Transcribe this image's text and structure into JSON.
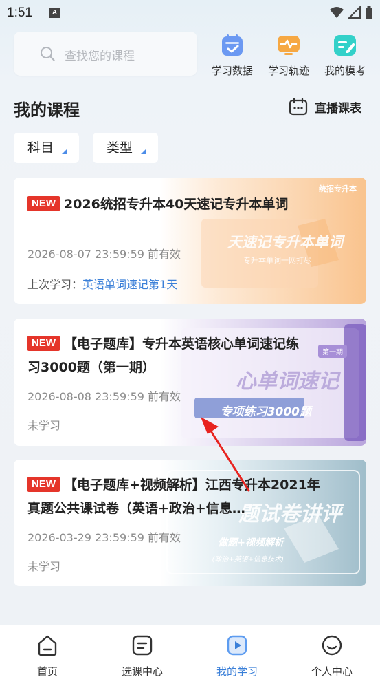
{
  "status_bar": {
    "time": "1:51",
    "a_badge": "A"
  },
  "search": {
    "placeholder": "查找您的课程"
  },
  "quick_actions": [
    {
      "label": "学习数据",
      "icon": "calendar-check-icon",
      "color": "#5b8cf0"
    },
    {
      "label": "学习轨迹",
      "icon": "monitor-wave-icon",
      "color": "#f5a13a"
    },
    {
      "label": "我的模考",
      "icon": "edit-note-icon",
      "color": "#2fd0c8"
    }
  ],
  "section": {
    "title": "我的课程",
    "live_schedule": "直播课表"
  },
  "filters": {
    "subject": "科目",
    "type": "类型"
  },
  "courses": [
    {
      "badge": "NEW",
      "title": "2026统招专升本40天速记专升本单词",
      "expiry": "2026-08-07 23:59:59 前有效",
      "last_label": "上次学习：",
      "last_link": "英语单词速记第1天",
      "cover_tag": "统招专升本",
      "cover_text": "天速记专升本单词",
      "cover_sub": "专升本单词一网打尽",
      "accent": "#f7b979"
    },
    {
      "badge": "NEW",
      "title": "【电子题库】专升本英语核心单词速记练习3000题（第一期）",
      "expiry": "2026-08-08 23:59:59 前有效",
      "status": "未学习",
      "cover_tag": "第一期",
      "cover_text": "心单词速记",
      "cover_sub": "专项练习3000题",
      "accent": "#8b6fc6"
    },
    {
      "badge": "NEW",
      "title": "【电子题库+视频解析】江西专升本2021年真题公共课试卷（英语+政治+信息…",
      "expiry": "2026-03-29 23:59:59 前有效",
      "status": "未学习",
      "cover_text": "题试卷讲评",
      "cover_sub": "做题+视频解析",
      "cover_sub2": "(政治+英语+信息技术)",
      "accent": "#7fa6b8"
    }
  ],
  "tabbar": [
    {
      "label": "首页",
      "icon": "home-icon",
      "active": false
    },
    {
      "label": "选课中心",
      "icon": "list-icon",
      "active": false
    },
    {
      "label": "我的学习",
      "icon": "play-icon",
      "active": true
    },
    {
      "label": "个人中心",
      "icon": "smile-icon",
      "active": false
    }
  ]
}
